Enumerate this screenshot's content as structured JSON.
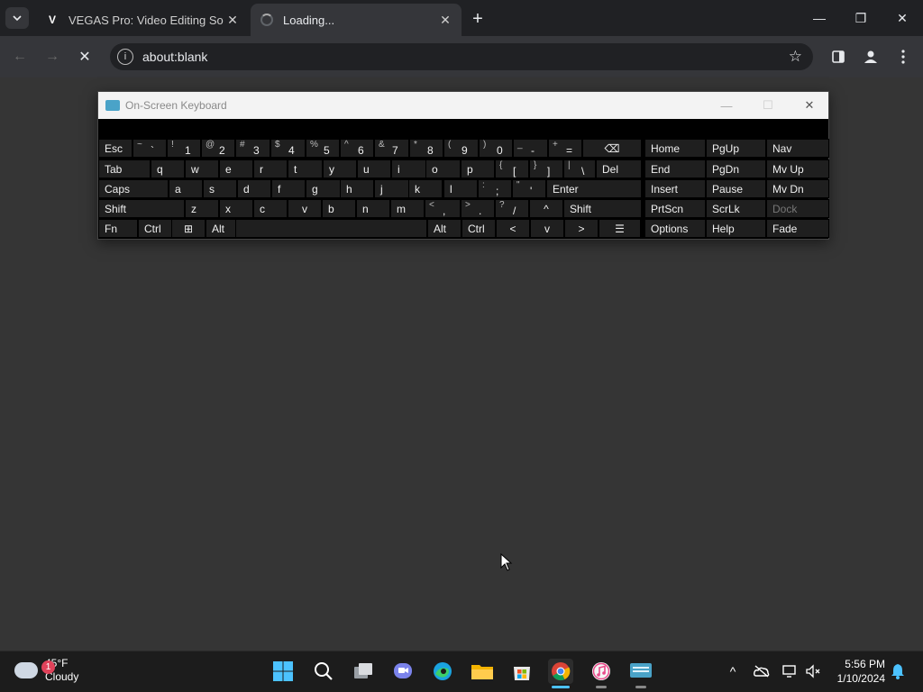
{
  "browser": {
    "tabs": [
      {
        "favicon": "V",
        "title": "VEGAS Pro: Video Editing Softw",
        "close": "✕"
      },
      {
        "title": "Loading...",
        "close": "✕"
      }
    ],
    "new_tab": "+",
    "window": {
      "minimize": "—",
      "restore": "❐",
      "close": "✕"
    },
    "address": "about:blank",
    "back": "←",
    "forward": "→",
    "stop": "✕"
  },
  "osk": {
    "title": "On-Screen Keyboard",
    "controls": {
      "minimize": "—",
      "maximize": "☐",
      "close": "✕"
    },
    "rows": [
      {
        "keys": [
          {
            "l": "Esc"
          },
          {
            "s": "~",
            "m": "`"
          },
          {
            "s": "!",
            "m": "1"
          },
          {
            "s": "@",
            "m": "2"
          },
          {
            "s": "#",
            "m": "3"
          },
          {
            "s": "$",
            "m": "4"
          },
          {
            "s": "%",
            "m": "5"
          },
          {
            "s": "^",
            "m": "6"
          },
          {
            "s": "&",
            "m": "7"
          },
          {
            "s": "*",
            "m": "8"
          },
          {
            "s": "(",
            "m": "9"
          },
          {
            "s": ")",
            "m": "0"
          },
          {
            "s": "_",
            "m": "-"
          },
          {
            "s": "+",
            "m": "="
          },
          {
            "l": "⌫"
          },
          {
            "l": "Home"
          },
          {
            "l": "PgUp"
          },
          {
            "l": "Nav"
          }
        ]
      },
      {
        "keys": [
          {
            "l": "Tab"
          },
          {
            "l": "q"
          },
          {
            "l": "w"
          },
          {
            "l": "e"
          },
          {
            "l": "r"
          },
          {
            "l": "t"
          },
          {
            "l": "y"
          },
          {
            "l": "u"
          },
          {
            "l": "i"
          },
          {
            "l": "o"
          },
          {
            "l": "p"
          },
          {
            "s": "{",
            "m": "["
          },
          {
            "s": "}",
            "m": "]"
          },
          {
            "s": "|",
            "m": "\\"
          },
          {
            "l": "Del"
          },
          {
            "l": "End"
          },
          {
            "l": "PgDn"
          },
          {
            "l": "Mv Up"
          }
        ]
      },
      {
        "keys": [
          {
            "l": "Caps"
          },
          {
            "l": "a"
          },
          {
            "l": "s"
          },
          {
            "l": "d"
          },
          {
            "l": "f"
          },
          {
            "l": "g"
          },
          {
            "l": "h"
          },
          {
            "l": "j"
          },
          {
            "l": "k"
          },
          {
            "l": "l"
          },
          {
            "s": ":",
            "m": ";"
          },
          {
            "s": "\"",
            "m": "'"
          },
          {
            "l": "Enter"
          },
          {
            "l": "Insert"
          },
          {
            "l": "Pause"
          },
          {
            "l": "Mv Dn"
          }
        ]
      },
      {
        "keys": [
          {
            "l": "Shift"
          },
          {
            "l": "z"
          },
          {
            "l": "x"
          },
          {
            "l": "c"
          },
          {
            "l": "v"
          },
          {
            "l": "b"
          },
          {
            "l": "n"
          },
          {
            "l": "m"
          },
          {
            "s": "<",
            "m": ","
          },
          {
            "s": ">",
            "m": "."
          },
          {
            "s": "?",
            "m": "/"
          },
          {
            "l": "^"
          },
          {
            "l": "Shift"
          },
          {
            "l": "PrtScn"
          },
          {
            "l": "ScrLk"
          },
          {
            "l": "Dock"
          }
        ]
      },
      {
        "keys": [
          {
            "l": "Fn"
          },
          {
            "l": "Ctrl"
          },
          {
            "l": "⊞"
          },
          {
            "l": "Alt"
          },
          {
            "l": ""
          },
          {
            "l": "Alt"
          },
          {
            "l": "Ctrl"
          },
          {
            "l": "<"
          },
          {
            "l": "v"
          },
          {
            "l": ">"
          },
          {
            "l": "☰"
          },
          {
            "l": "Options"
          },
          {
            "l": "Help"
          },
          {
            "l": "Fade"
          }
        ]
      }
    ]
  },
  "taskbar": {
    "weather": {
      "temp": "45°F",
      "condition": "Cloudy",
      "badge": "1"
    },
    "clock": {
      "time": "5:56 PM",
      "date": "1/10/2024"
    },
    "tray_chevron": "^"
  }
}
